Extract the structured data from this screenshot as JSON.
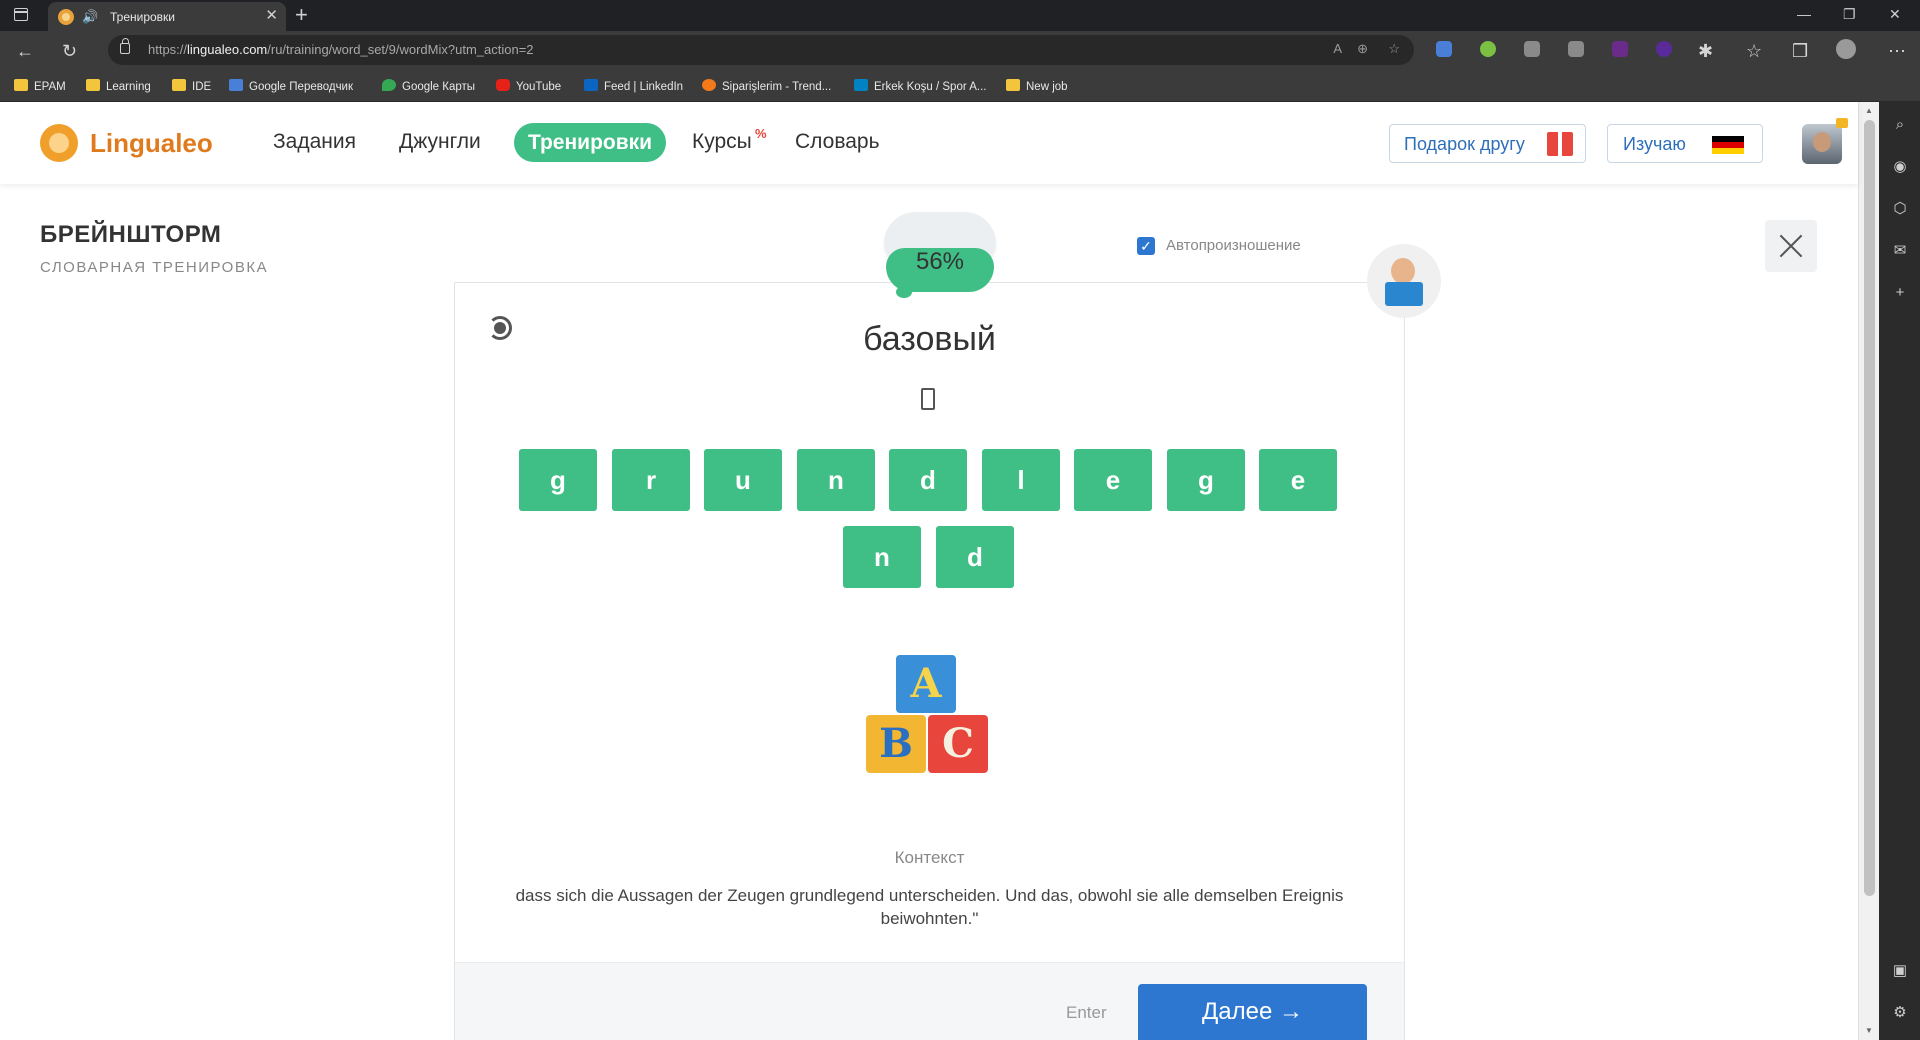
{
  "browser": {
    "tab_title": "Тренировки",
    "tab_close": "✕",
    "new_tab": "+",
    "win_min": "—",
    "win_max": "❐",
    "win_close": "✕",
    "url_prefix": "https://",
    "url_domain": "lingualeo.com",
    "url_path": "/ru/training/word_set/9/wordMix?utm_action=2",
    "bookmarks": [
      "EPAM",
      "Learning",
      "IDE",
      "Google Переводчик",
      "Google Карты",
      "YouTube",
      "Feed | LinkedIn",
      "Siparişlerim - Trend...",
      "Erkek Koşu / Spor A...",
      "New job"
    ]
  },
  "header": {
    "logo": "Lingualeo",
    "nav": [
      "Задания",
      "Джунгли",
      "Тренировки",
      "Курсы",
      "Словарь"
    ],
    "courses_badge": "%",
    "gift_label": "Подарок другу",
    "learn_label": "Изучаю",
    "flag_colors": [
      "#000000",
      "#dd0000",
      "#ffce00"
    ]
  },
  "training": {
    "title": "БРЕЙНШТОРМ",
    "subtitle": "СЛОВАРНАЯ ТРЕНИРОВКА",
    "progress": "56%",
    "auto_pronounce_label": "Автопроизношение",
    "auto_pronounce_checked": true,
    "word": "базовый",
    "letters_row1": [
      "g",
      "r",
      "u",
      "n",
      "d",
      "l",
      "e",
      "g",
      "e"
    ],
    "letters_row2": [
      "n",
      "d"
    ],
    "image_blocks": [
      "A",
      "B",
      "C"
    ],
    "context_label": "Контекст",
    "context_text": "dass sich die Aussagen der Zeugen grundlegend unterscheiden. Und das, obwohl sie alle demselben Ereignis beiwohnten.\"",
    "enter_hint": "Enter",
    "next_label": "Далее →"
  },
  "colors": {
    "accent_green": "#3fbf86",
    "primary_blue": "#2e77d0",
    "logo_orange": "#e07b1d"
  }
}
